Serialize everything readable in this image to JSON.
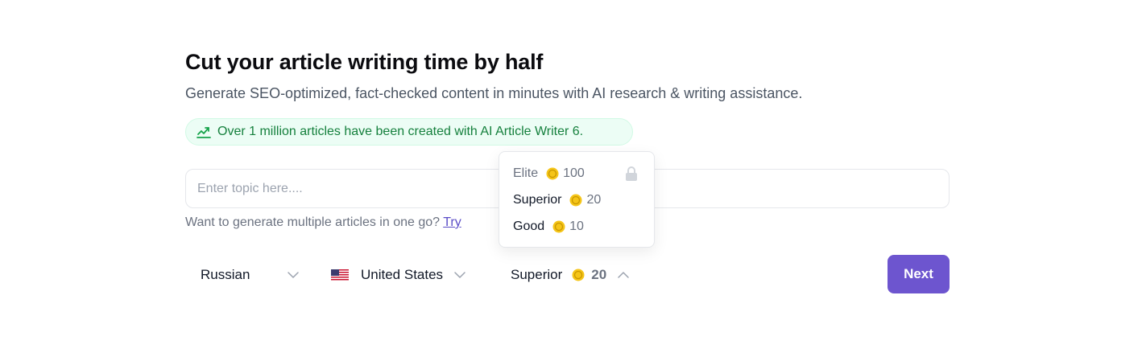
{
  "header": {
    "title": "Cut your article writing time by half",
    "subtitle": "Generate SEO-optimized, fact-checked content in minutes with AI research & writing assistance."
  },
  "banner": {
    "icon": "chart-trend-icon",
    "text": "Over 1 million articles have been created with AI Article Writer 6."
  },
  "topic": {
    "value": "",
    "placeholder": "Enter topic here...."
  },
  "multi": {
    "text": "Want to generate multiple articles in one go?",
    "link_label": "Try"
  },
  "controls": {
    "language": {
      "selected": "Russian"
    },
    "region": {
      "selected": "United States",
      "icon": "us-flag-icon"
    },
    "quality": {
      "selected": "Superior",
      "credits": "20"
    }
  },
  "quality_dropdown": {
    "options": [
      {
        "name": "Elite",
        "credits": "100",
        "locked": true
      },
      {
        "name": "Superior",
        "credits": "20",
        "locked": false
      },
      {
        "name": "Good",
        "credits": "10",
        "locked": false
      }
    ]
  },
  "actions": {
    "next_label": "Next"
  },
  "colors": {
    "accent": "#6d55cf",
    "banner_text": "#15803d",
    "banner_bg": "#ecfdf5",
    "coin": "#f5c518"
  }
}
